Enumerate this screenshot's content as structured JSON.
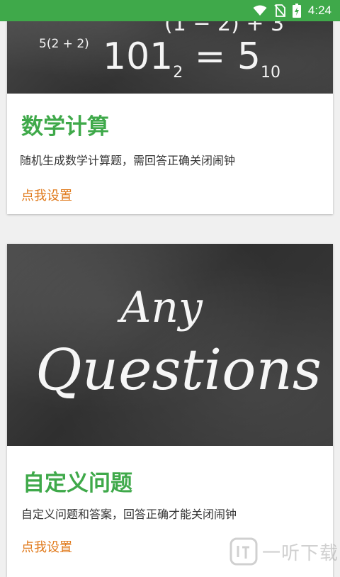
{
  "status_bar": {
    "time": "4:24",
    "icons": [
      "wifi-icon",
      "no-sim-icon",
      "battery-charging-icon"
    ]
  },
  "cards": [
    {
      "image": {
        "small_text": "5(2 + 2)",
        "top_text": "(1 − 2) + 3",
        "main_left": "101",
        "main_left_sub": "2",
        "main_eq": " = 5",
        "main_right_sub": "10"
      },
      "title": "数学计算",
      "description": "随机生成数学计算题，需回答正确关闭闹钟",
      "link": "点我设置"
    },
    {
      "image": {
        "line1": "Any",
        "line2": "Questions"
      },
      "title": "自定义问题",
      "description": "自定义问题和答案，回答正确才能关闭闹钟",
      "link": "点我设置"
    }
  ],
  "watermark": {
    "text": "一听下载"
  },
  "colors": {
    "accent_green": "#3fa94a",
    "link_orange": "#e07a1c"
  }
}
